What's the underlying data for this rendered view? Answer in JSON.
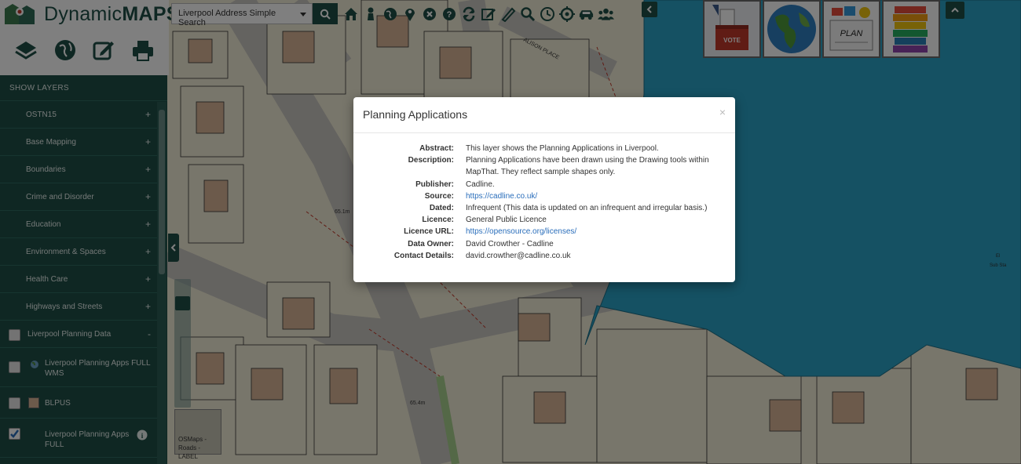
{
  "header": {
    "logo_dynamic": "Dynamic",
    "logo_maps": "MAPS",
    "search_select": "Liverpool Address Simple Search"
  },
  "toolbar": {
    "icons": [
      "home-icon",
      "person-pin-icon",
      "globe-icon",
      "map-marker-icon",
      "close-circle-icon",
      "help-circle-icon",
      "refresh-icon",
      "edit-icon",
      "ruler-icon",
      "search-icon",
      "clock-icon",
      "target-icon",
      "car-icon",
      "users-icon"
    ]
  },
  "side_icons": [
    "layers-icon",
    "globe-icon",
    "edit-icon",
    "print-icon"
  ],
  "layers": {
    "heading": "SHOW LAYERS",
    "groups": [
      {
        "label": "OSTN15",
        "toggle": "+"
      },
      {
        "label": "Base Mapping",
        "toggle": "+"
      },
      {
        "label": "Boundaries",
        "toggle": "+"
      },
      {
        "label": "Crime and Disorder",
        "toggle": "+"
      },
      {
        "label": "Education",
        "toggle": "+"
      },
      {
        "label": "Environment & Spaces",
        "toggle": "+"
      },
      {
        "label": "Health Care",
        "toggle": "+"
      },
      {
        "label": "Highways and Streets",
        "toggle": "+"
      }
    ],
    "planning_group": {
      "label": "Liverpool Planning Data",
      "toggle": "-"
    },
    "sub_layers": [
      {
        "label": "Liverpool Planning Apps FULL WMS",
        "checked": false
      },
      {
        "label": "BLPUS",
        "checked": false
      },
      {
        "label": "Liverpool Planning Apps FULL",
        "checked": true
      }
    ]
  },
  "basemap": {
    "label": "OSMaps - Roads - LABEL"
  },
  "map_labels": {
    "street": "ALISON PLACE",
    "height1": "65.1m",
    "height2": "65.4m",
    "sub_sta_1": "El",
    "sub_sta_2": "Sub Sta"
  },
  "image_buttons": [
    {
      "name": "vote",
      "label": "VOTE"
    },
    {
      "name": "globe",
      "label": ""
    },
    {
      "name": "plan",
      "label": "PLAN"
    },
    {
      "name": "books",
      "label": ""
    }
  ],
  "modal": {
    "title": "Planning Applications",
    "close": "×",
    "rows": [
      {
        "label": "Abstract:",
        "value": "This layer shows the Planning Applications in Liverpool.",
        "link": false
      },
      {
        "label": "Description:",
        "value": "Planning Applications have been drawn using the Drawing tools within MapThat. They reflect sample shapes only.",
        "link": false
      },
      {
        "label": "Publisher:",
        "value": "Cadline.",
        "link": false
      },
      {
        "label": "Source:",
        "value": "https://cadline.co.uk/",
        "link": true
      },
      {
        "label": "Dated:",
        "value": "Infrequent (This data is updated on an infrequent and irregular basis.)",
        "link": false
      },
      {
        "label": "Licence:",
        "value": "General Public Licence",
        "link": false
      },
      {
        "label": "Licence URL:",
        "value": "https://opensource.org/licenses/",
        "link": true
      },
      {
        "label": "Data Owner:",
        "value": "David Crowther - Cadline",
        "link": false
      },
      {
        "label": "Contact Details:",
        "value": "david.crowther@cadline.co.uk",
        "link": false
      }
    ]
  },
  "colors": {
    "primary": "#1f4f47",
    "link": "#2a6ebb",
    "planning_fill": "#2aa3c6"
  }
}
